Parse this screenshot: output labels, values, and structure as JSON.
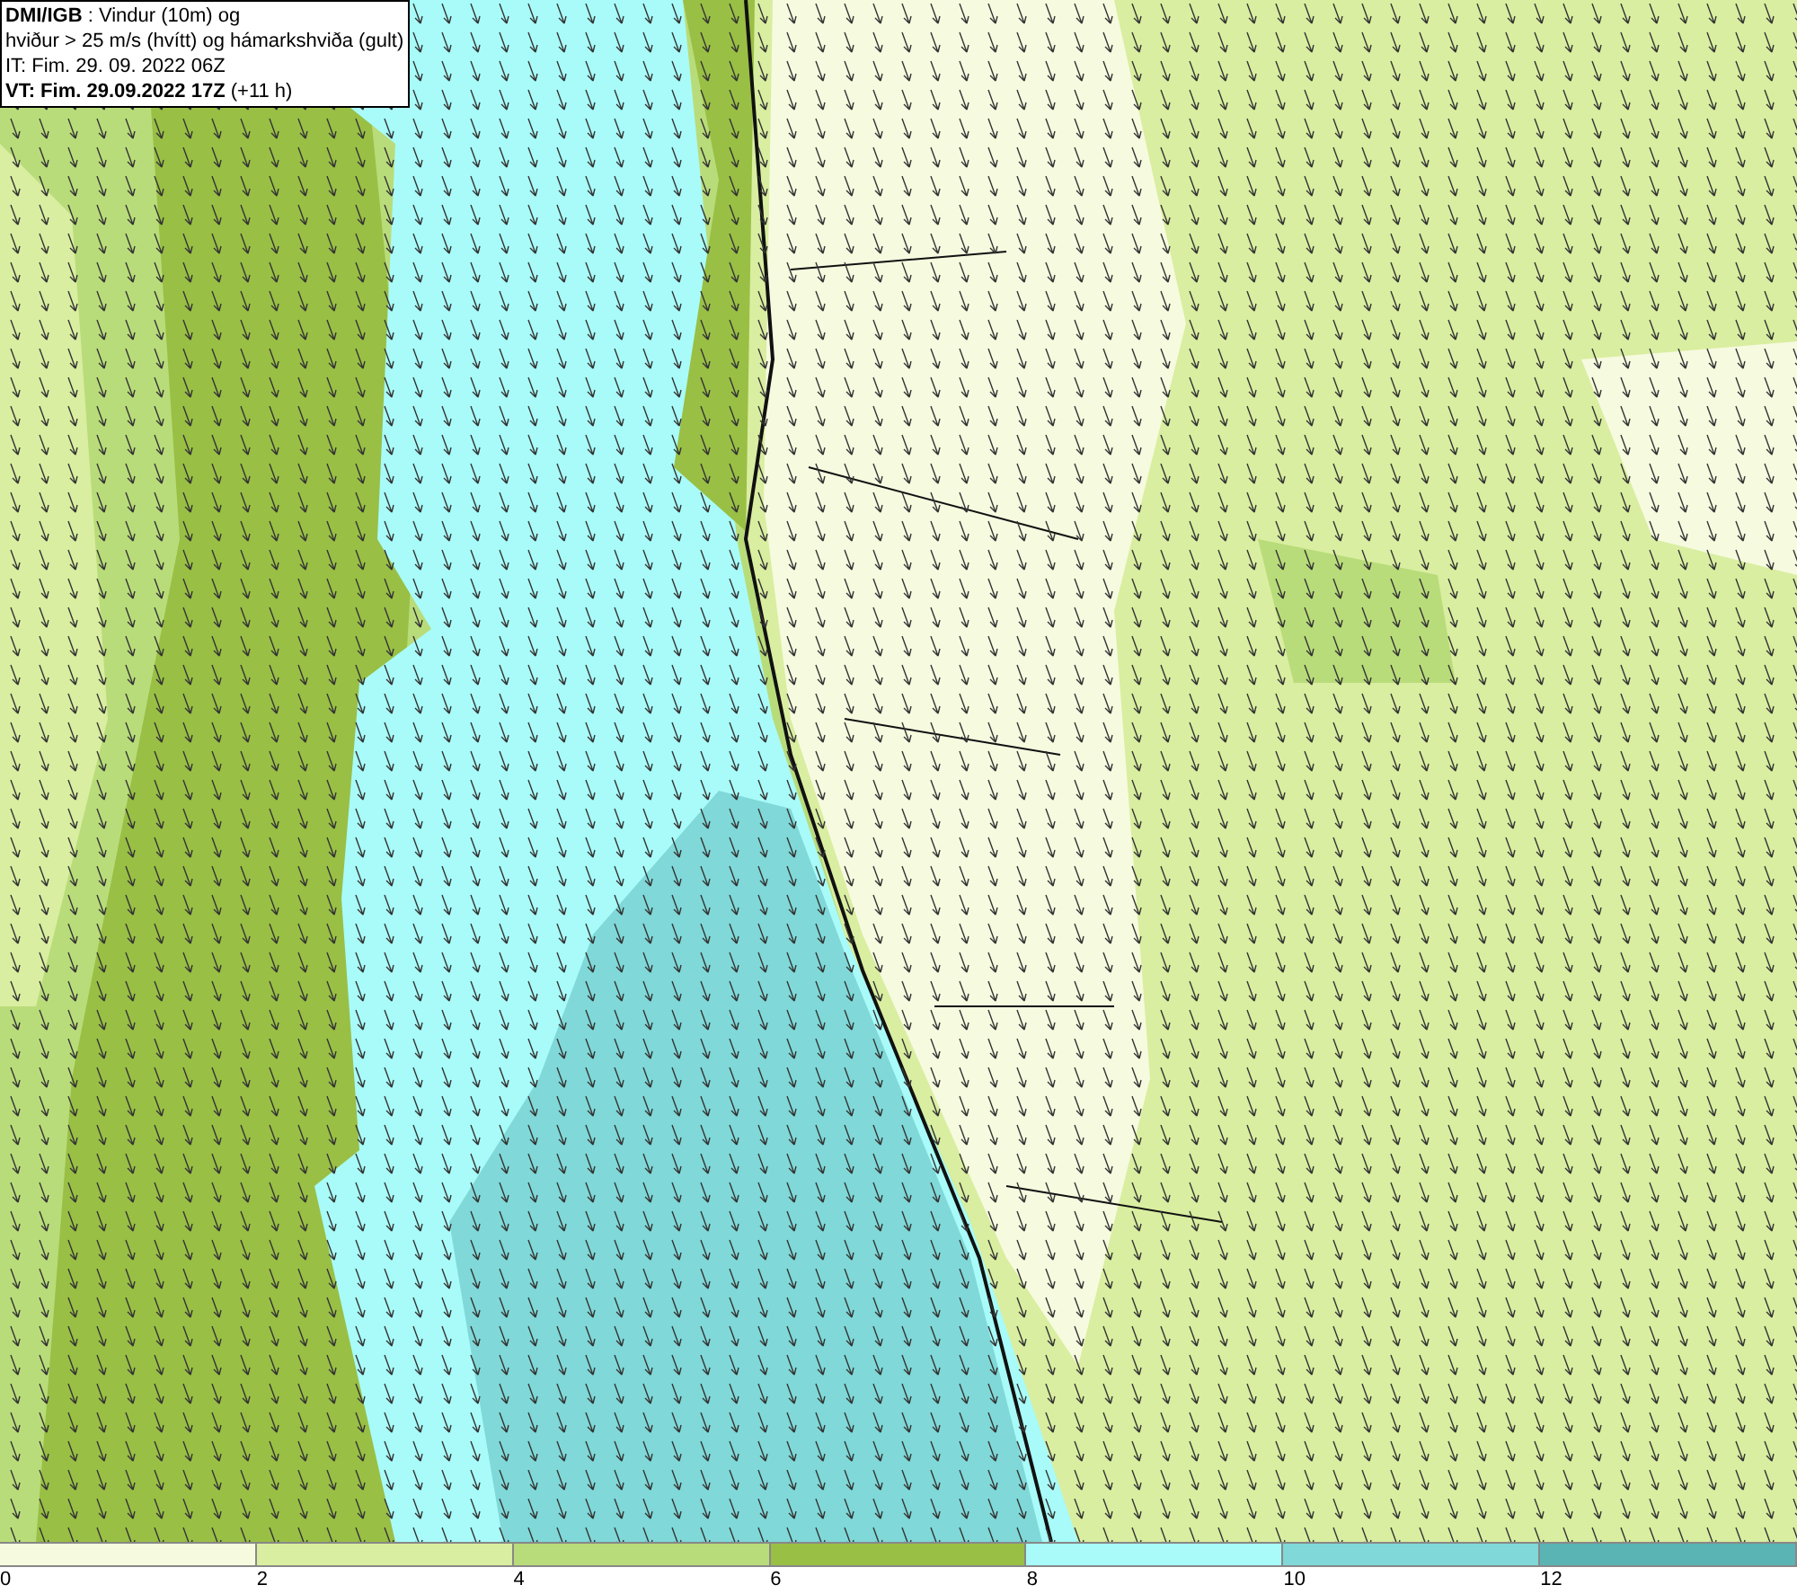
{
  "title_box": {
    "lines": [
      "**DMI/IGB** : Vindur (10m) og",
      "hviður > 25 m/s (hvítt) og hámarkshviða (gult)",
      "IT: Fim. 29. 09. 2022 06Z",
      "**VT: Fim. 29.09.2022 17Z** (+11 h)"
    ]
  },
  "legend": [
    {
      "label": "0",
      "color": "#f6fadf"
    },
    {
      "label": "2",
      "color": "#d9eea0"
    },
    {
      "label": "4",
      "color": "#b9dc7a"
    },
    {
      "label": "6",
      "color": "#99bf45"
    },
    {
      "label": "8",
      "color": "#a8fbf8"
    },
    {
      "label": "10",
      "color": "#80d8d8"
    },
    {
      "label": "12",
      "color": "#5ab4b4"
    }
  ]
}
